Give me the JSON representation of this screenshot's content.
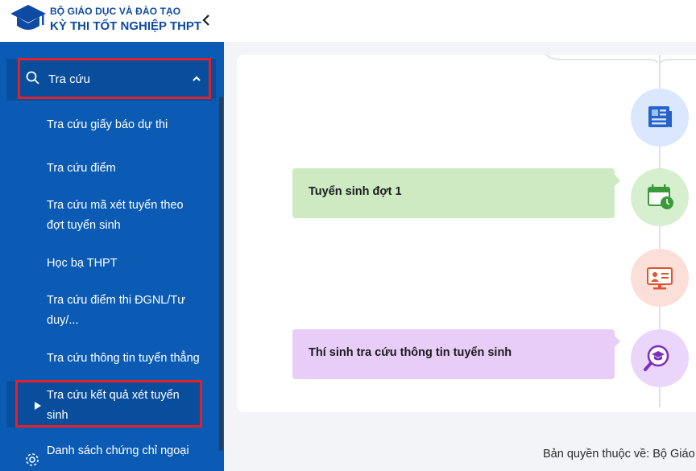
{
  "header": {
    "brand_line1": "BỘ GIÁO DỤC VÀ ĐÀO TẠO",
    "brand_line2": "KỲ THI TỐT NGHIỆP THPT"
  },
  "sidebar": {
    "section_label": "Tra cứu",
    "items": [
      {
        "label_line1": "Tra cứu giấy báo dự thi",
        "label_line2": ""
      },
      {
        "label_line1": "Tra cứu điểm",
        "label_line2": ""
      },
      {
        "label_line1": "Tra cứu mã xét tuyển theo",
        "label_line2": "đợt tuyển sinh"
      },
      {
        "label_line1": "Học bạ THPT",
        "label_line2": ""
      },
      {
        "label_line1": "Tra cứu điểm thi ĐGNL/Tư",
        "label_line2": "duy/..."
      },
      {
        "label_line1": "Tra cứu thông tin tuyển thẳng",
        "label_line2": ""
      },
      {
        "label_line1": "Tra cứu kết quả xét tuyển",
        "label_line2": "sinh"
      }
    ],
    "next_section_label": "Danh sách chứng chỉ ngoại"
  },
  "timeline": {
    "event1": "Tuyển sinh đợt 1",
    "event2": "Thí sinh tra cứu thông tin tuyển sinh"
  },
  "footer": {
    "copyright": "Bản quyền thuộc về: Bộ Giáo"
  },
  "colors": {
    "sidebar_bg": "#0b5bb5",
    "highlight_box": "#e3202a",
    "bubble_green": "#cdeac3",
    "bubble_purple": "#e8cdf8"
  }
}
